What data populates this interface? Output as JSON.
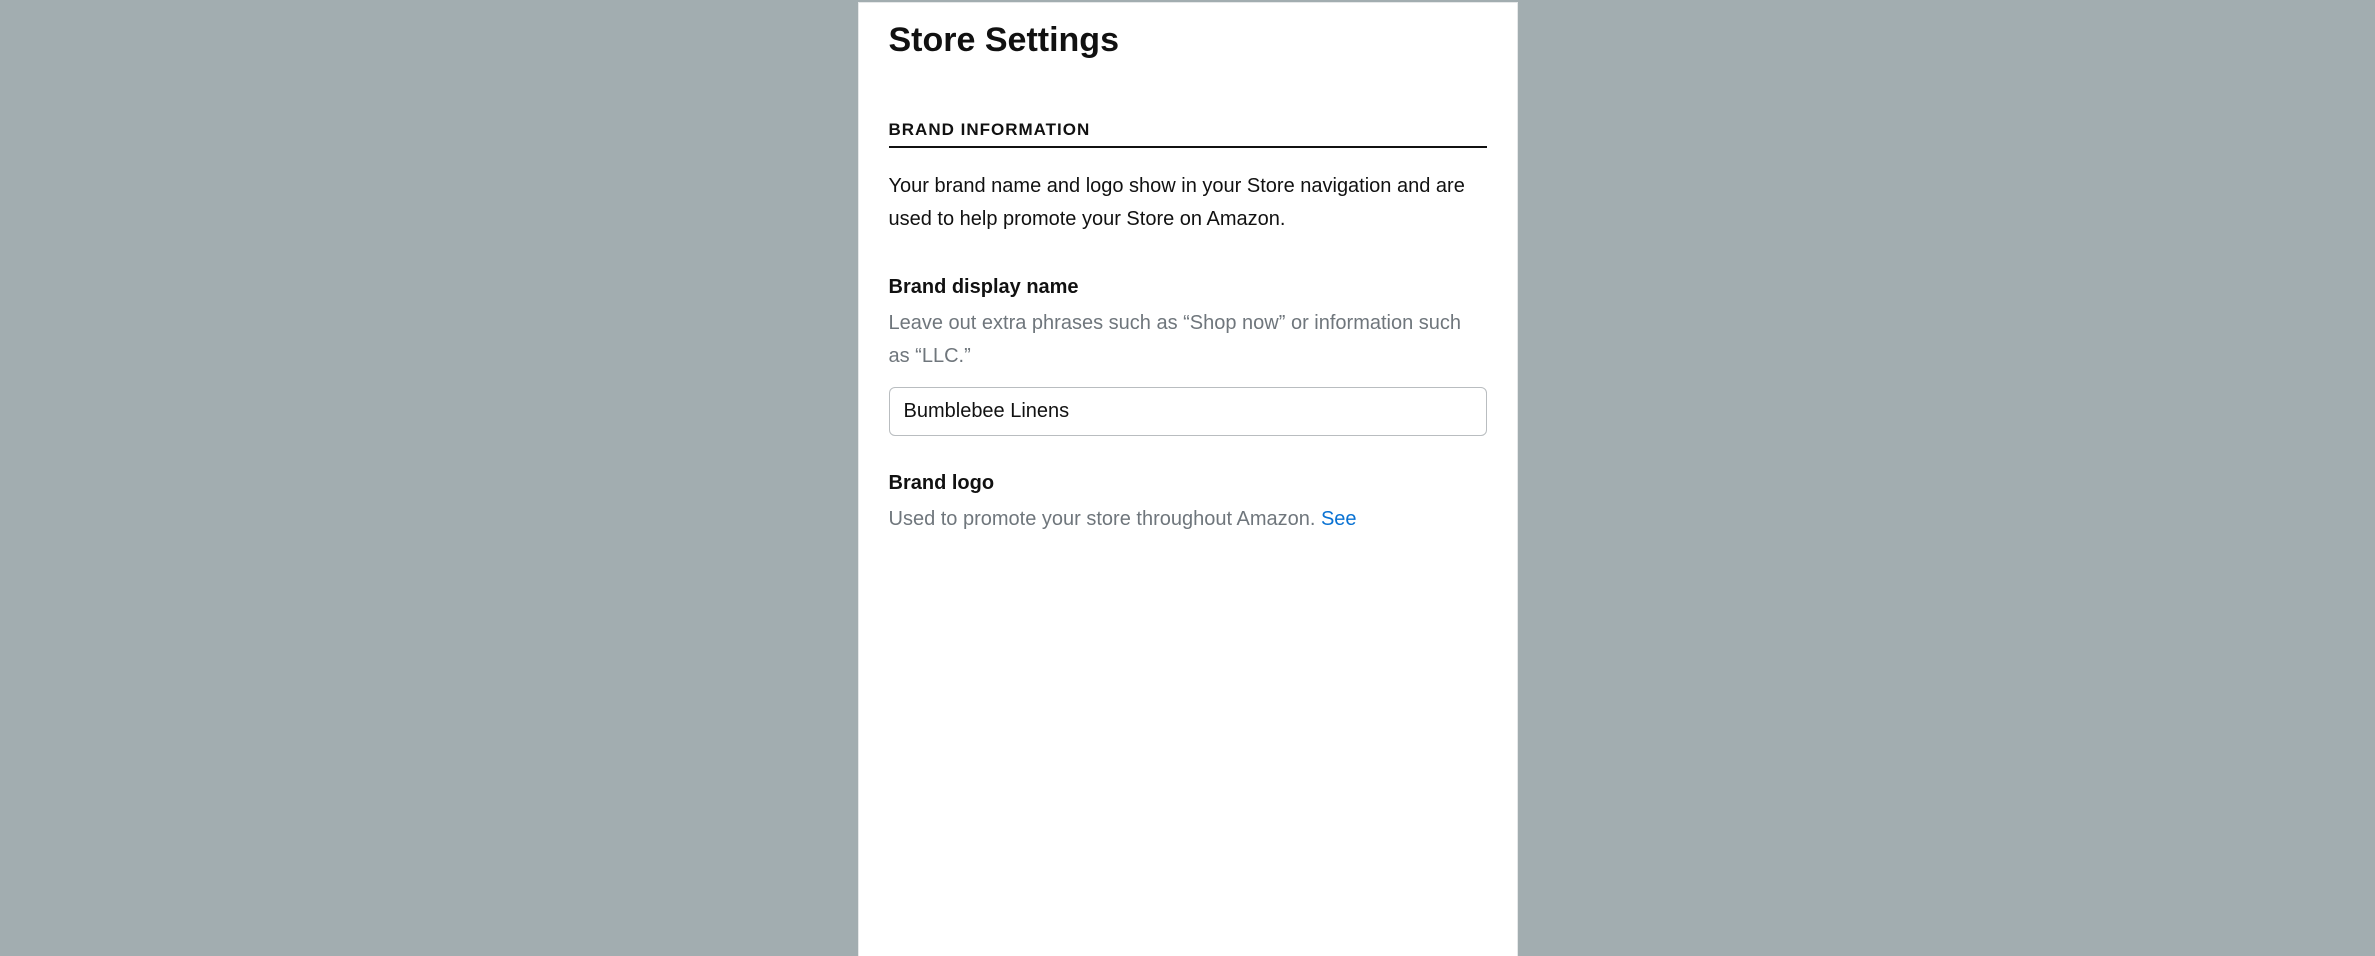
{
  "page": {
    "title": "Store Settings"
  },
  "brand_section": {
    "header": "BRAND INFORMATION",
    "description": "Your brand name and logo show in your Store navigation and are used to help promote your Store on Amazon."
  },
  "brand_display_name": {
    "label": "Brand display name",
    "help": "Leave out extra phrases such as “Shop now” or information such as “LLC.”",
    "value": "Bumblebee Linens"
  },
  "brand_logo": {
    "label": "Brand logo",
    "desc_prefix": "Used to promote your store throughout Amazon. ",
    "link_text": "See"
  }
}
